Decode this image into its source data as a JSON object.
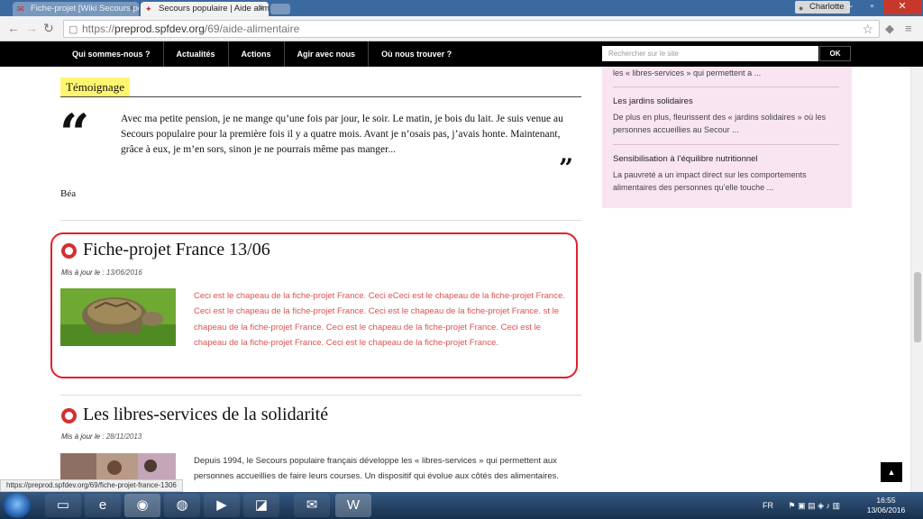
{
  "browser": {
    "tabs": [
      {
        "label": "Fiche-projet [Wiki Secours populaire]",
        "active": false
      },
      {
        "label": "Secours populaire | Aide alimentaire",
        "active": true
      }
    ],
    "profile_name": "Charlotte",
    "url_prefix": "https://",
    "url_host": "preprod.spfdev.org",
    "url_path": "/69/aide-alimentaire",
    "status_url": "https://preprod.spfdev.org/69/fiche-projet-france-1306"
  },
  "site_nav": {
    "items": [
      "Qui sommes-nous ?",
      "Actualités",
      "Actions",
      "Agir avec nous",
      "Où nous trouver ?"
    ],
    "search_placeholder": "Rechercher sur le site",
    "ok_label": "OK"
  },
  "testimony": {
    "label": "Témoignage",
    "text": "Avec ma petite pension, je ne mange qu’une fois par jour, le soir. Le matin, je bois du lait. Je suis venue au Secours populaire pour la première fois il y a quatre mois. Avant je n’osais pas, j’avais honte. Maintenant, grâce à eux, je m’en sors, sinon je ne pourrais même pas manger...",
    "author": "Béa"
  },
  "articles": [
    {
      "title": "Fiche-projet France 13/06",
      "date_label": "Mis à jour le :",
      "date": "13/06/2016",
      "excerpt": "Ceci est le chapeau de la fiche-projet France. Ceci eCeci est le chapeau de la fiche-projet France. Ceci est le chapeau de la fiche-projet France. Ceci est le chapeau de la fiche-projet France. st le chapeau de la fiche-projet France. Ceci est le chapeau de la fiche-projet France. Ceci est le chapeau de la fiche-projet France. Ceci est le chapeau de la fiche-projet France."
    },
    {
      "title": "Les libres-services de la solidarité",
      "date_label": "Mis à jour le :",
      "date": "28/11/2013",
      "excerpt": "Depuis 1994, le Secours populaire français développe les « libres-services » qui permettent aux personnes accueillies de faire leurs courses. Un dispositif qui évolue aux côtés des alimentaires."
    }
  ],
  "sidebar": {
    "top_text": "les « libres-services » qui permettent a ...",
    "items": [
      {
        "title": "Les jardins solidaires",
        "desc": "De plus en plus, fleurissent des « jardins solidaires » où les personnes accueillies au Secour ..."
      },
      {
        "title": "Sensibilisation à l’équilibre nutritionnel",
        "desc": "La pauvreté a un impact direct sur les comportements alimentaires des personnes qu’elle touche ..."
      }
    ]
  },
  "taskbar": {
    "lang": "FR",
    "time": "16:55",
    "date": "13/06/2016"
  },
  "colors": {
    "highlight": "#e0202d",
    "excerpt_red": "#d9534f",
    "label_yellow": "#fff66f",
    "sidebar_bg": "#f9e5f2"
  }
}
